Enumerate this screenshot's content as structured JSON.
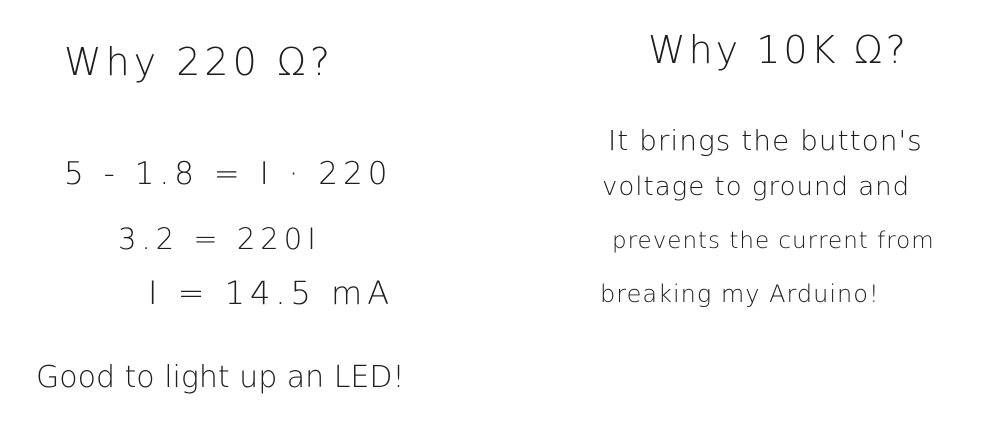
{
  "left_column": {
    "heading": "Why 220 Ω?",
    "equation_lines": [
      "5 - 1.8 = I · 220",
      "3.2 = 220I",
      "I = 14.5 mA"
    ],
    "footer": "Good to light up an LED!"
  },
  "right_column": {
    "heading": "Why 10K Ω?",
    "paragraph_lines": [
      "It brings the button's",
      "voltage to ground and",
      "prevents the current from",
      "breaking my Arduino!"
    ]
  }
}
